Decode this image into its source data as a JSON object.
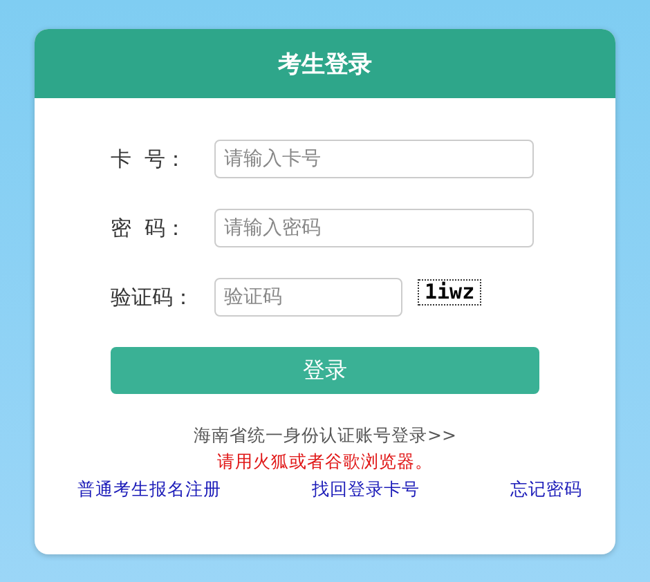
{
  "title": "考生登录",
  "fields": [
    {
      "label": "卡  号：",
      "placeholder": "请输入卡号",
      "kind": "text"
    },
    {
      "label": "密  码：",
      "placeholder": "请输入密码",
      "kind": "password"
    },
    {
      "label": "验证码：",
      "placeholder": "验证码",
      "kind": "captcha",
      "captcha": "1iwz"
    }
  ],
  "login_button": "登录",
  "sso_link": "海南省统一身份认证账号登录>>",
  "browser_notice": "请用火狐或者谷歌浏览器。",
  "links": [
    "普通考生报名注册",
    "找回登录卡号",
    "忘记密码"
  ]
}
